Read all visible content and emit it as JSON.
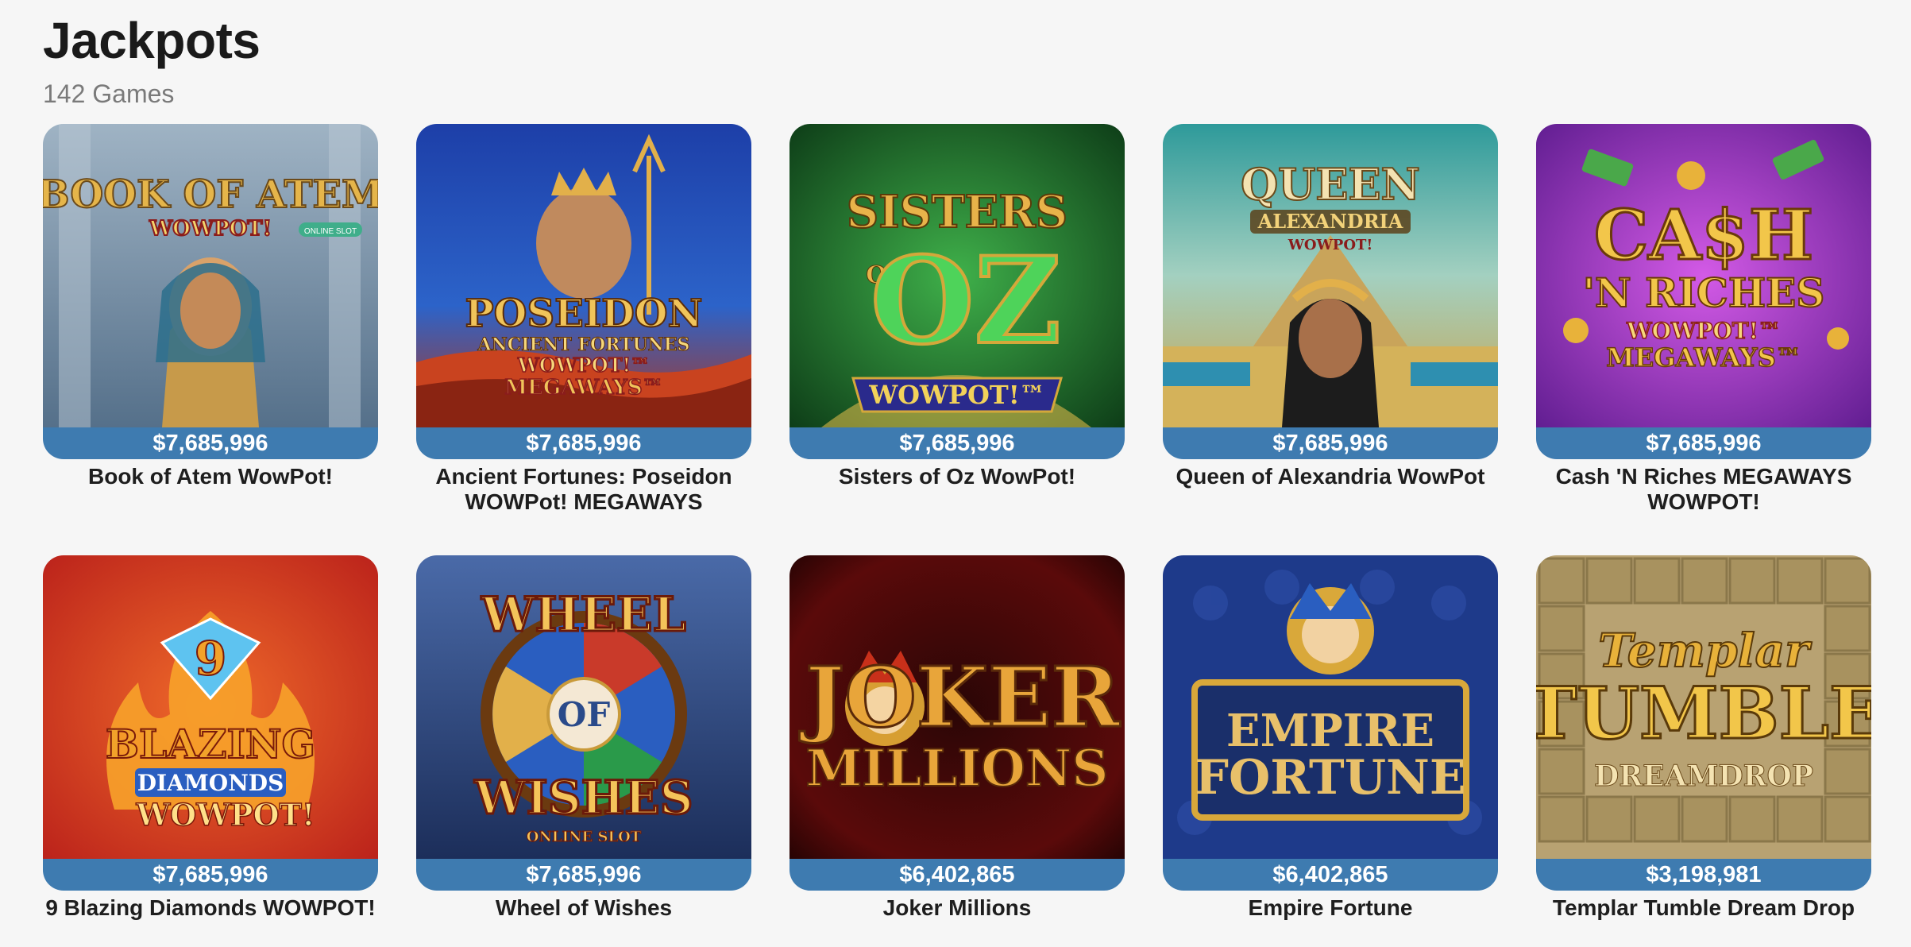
{
  "page": {
    "title": "Jackpots",
    "subtitle": "142 Games"
  },
  "colors": {
    "jackpot_bar": "#3e7bb0",
    "background": "#f6f6f6"
  },
  "games": [
    {
      "name": "Book of Atem WowPot!",
      "jackpot": "$7,685,996",
      "art": {
        "line1": "BOOK OF ATEM",
        "line2": "WOWPOT!",
        "line3": "ONLINE SLOT"
      }
    },
    {
      "name": "Ancient Fortunes: Poseidon WOWPot! MEGAWAYS",
      "jackpot": "$7,685,996",
      "art": {
        "line1": "POSEIDON",
        "line2": "ANCIENT FORTUNES",
        "line3": "WOWPOT!™",
        "line4": "MEGAWAYS™"
      }
    },
    {
      "name": "Sisters of Oz WowPot!",
      "jackpot": "$7,685,996",
      "art": {
        "line1": "SISTERS",
        "line2": "OF",
        "line3": "OZ",
        "line4": "WOWPOT!™"
      }
    },
    {
      "name": "Queen of Alexandria WowPot",
      "jackpot": "$7,685,996",
      "art": {
        "line1": "QUEEN",
        "line2": "ALEXANDRIA",
        "line3": "WOWPOT!"
      }
    },
    {
      "name": "Cash 'N Riches MEGAWAYS WOWPOT!",
      "jackpot": "$7,685,996",
      "art": {
        "line1": "CA$H",
        "line2": "'N RICHES",
        "line3": "WOWPOT!™",
        "line4": "MEGAWAYS™"
      }
    },
    {
      "name": "9 Blazing Diamonds WOWPOT!",
      "jackpot": "$7,685,996",
      "art": {
        "line1": "9",
        "line2": "BLAZING",
        "line3": "DIAMONDS",
        "line4": "WOWPOT!"
      }
    },
    {
      "name": "Wheel of Wishes",
      "jackpot": "$7,685,996",
      "art": {
        "line1": "WHEEL",
        "line2": "OF",
        "line3": "WISHES",
        "line4": "ONLINE SLOT"
      }
    },
    {
      "name": "Joker Millions",
      "jackpot": "$6,402,865",
      "art": {
        "line1": "JOKER",
        "line2": "MILLIONS"
      }
    },
    {
      "name": "Empire Fortune",
      "jackpot": "$6,402,865",
      "art": {
        "line1": "EMPIRE",
        "line2": "FORTUNE"
      }
    },
    {
      "name": "Templar Tumble Dream Drop",
      "jackpot": "$3,198,981",
      "art": {
        "line1": "Templar",
        "line2": "TUMBLE",
        "line3": "DREAMDROP"
      }
    }
  ]
}
